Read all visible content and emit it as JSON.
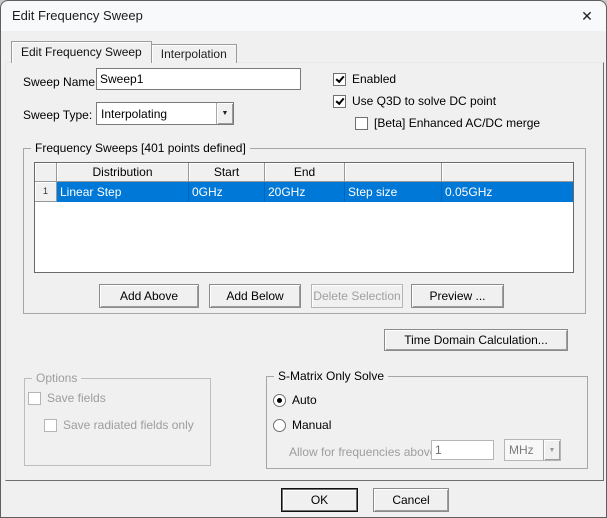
{
  "window": {
    "title": "Edit Frequency Sweep"
  },
  "icons": {
    "close": "✕",
    "dropdown": "▼"
  },
  "colors": {
    "selection": "#0078d7",
    "dialog_bg": "#f0f0f0",
    "titlebar_bg": "#f7f9fa"
  },
  "tabs": [
    {
      "label": "Edit Frequency Sweep",
      "active": true
    },
    {
      "label": "Interpolation",
      "active": false
    }
  ],
  "fields": {
    "sweep_name_label": "Sweep Name:",
    "sweep_name_value": "Sweep1",
    "sweep_type_label": "Sweep Type:",
    "sweep_type_value": "Interpolating"
  },
  "checkboxes": {
    "enabled": {
      "label": "Enabled",
      "checked": true
    },
    "use_q3d": {
      "label": "Use Q3D to solve DC point",
      "checked": true
    },
    "beta_merge": {
      "label": "[Beta] Enhanced AC/DC merge",
      "checked": false
    }
  },
  "frequency_sweeps": {
    "group_title": "Frequency Sweeps [401 points defined]",
    "table": {
      "columns": [
        "",
        "Distribution",
        "Start",
        "End",
        "",
        ""
      ],
      "rows": [
        {
          "num": "1",
          "selected": true,
          "cells": [
            "Linear Step",
            "0GHz",
            "20GHz",
            "Step size",
            "0.05GHz"
          ]
        }
      ]
    },
    "buttons": [
      {
        "label": "Add Above",
        "enabled": true
      },
      {
        "label": "Add Below",
        "enabled": true
      },
      {
        "label": "Delete Selection",
        "enabled": false
      },
      {
        "label": "Preview ...",
        "enabled": true
      }
    ]
  },
  "time_domain_button": "Time Domain Calculation...",
  "options_group": {
    "title": "Options",
    "save_fields": "Save fields",
    "save_fields_checked": false,
    "save_radiated": "Save radiated fields only",
    "save_radiated_checked": false
  },
  "smatrix_group": {
    "title": "S-Matrix Only Solve",
    "auto_label": "Auto",
    "auto_selected": true,
    "manual_label": "Manual",
    "manual_selected": false,
    "allow_label": "Allow for frequencies above",
    "freq_value": "1",
    "unit_value": "MHz"
  },
  "footer": {
    "ok": "OK",
    "cancel": "Cancel"
  }
}
